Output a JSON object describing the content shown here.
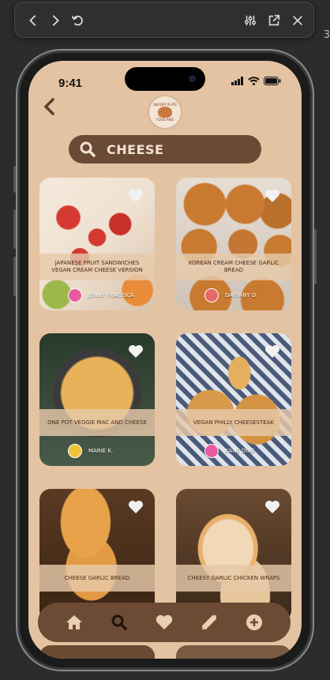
{
  "status": {
    "time": "9:41"
  },
  "edge_text": "3",
  "app": {
    "logo_text_top": "SNOOPY PLATE",
    "logo_text_bottom": "FOOD AND",
    "search": {
      "query": "CHEESE"
    }
  },
  "recipes": [
    {
      "title": "JAPANESE FRUIT SANDWICHES VEGAN CREAM CHEESE VERSION",
      "author": "JENNY FRACISCA"
    },
    {
      "title": "KOREAN CREAM CHEESE GARLIC BREAD",
      "author": "DAFFANY D."
    },
    {
      "title": "ONE POT VEGGIE MAC AND CHEESE",
      "author": "MARIE K."
    },
    {
      "title": "VEGAN PHILLY CHEESESTEAK",
      "author": "KANE DIAS"
    },
    {
      "title": "CHEESE GARLIC BREAD",
      "author": ""
    },
    {
      "title": "CHEESY GARLIC CHICKEN WRAPS",
      "author": ""
    }
  ],
  "nav": [
    "home-icon",
    "search-icon",
    "heart-icon",
    "recipes-icon",
    "add-icon"
  ],
  "colors": {
    "screen_bg": "#e4c3a2",
    "accent": "#6b4a35",
    "banner": "#e7c9aa"
  }
}
